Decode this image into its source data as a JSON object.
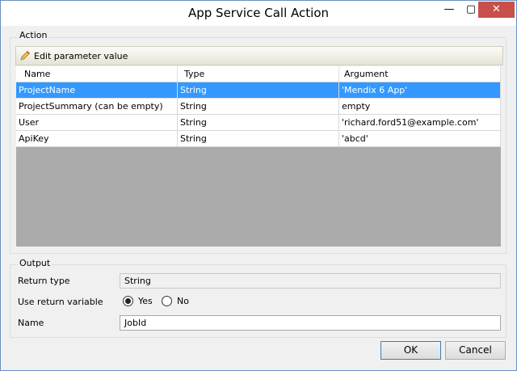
{
  "window": {
    "title": "App Service Call Action",
    "minimize_glyph": "—",
    "maximize_glyph": "▢",
    "close_glyph": "✕"
  },
  "action": {
    "group_label": "Action",
    "toolbar": {
      "edit_label": "Edit parameter value",
      "edit_icon": "pencil-icon"
    },
    "columns": [
      "Name",
      "Type",
      "Argument"
    ],
    "rows": [
      {
        "name": "ProjectName",
        "type": "String",
        "argument": "'Mendix 6 App'",
        "selected": true
      },
      {
        "name": "ProjectSummary (can be empty)",
        "type": "String",
        "argument": "empty",
        "selected": false
      },
      {
        "name": "User",
        "type": "String",
        "argument": "'richard.ford51@example.com'",
        "selected": false
      },
      {
        "name": "ApiKey",
        "type": "String",
        "argument": "'abcd'",
        "selected": false
      }
    ]
  },
  "output": {
    "group_label": "Output",
    "return_type_label": "Return type",
    "return_type_value": "String",
    "use_return_variable_label": "Use return variable",
    "yes_label": "Yes",
    "no_label": "No",
    "use_return_variable_selected": "Yes",
    "name_label": "Name",
    "name_value": "JobId"
  },
  "buttons": {
    "ok_label": "OK",
    "cancel_label": "Cancel"
  },
  "colors": {
    "selection": "#3399ff",
    "close_button": "#c7504a",
    "grid_background": "#ababab"
  }
}
